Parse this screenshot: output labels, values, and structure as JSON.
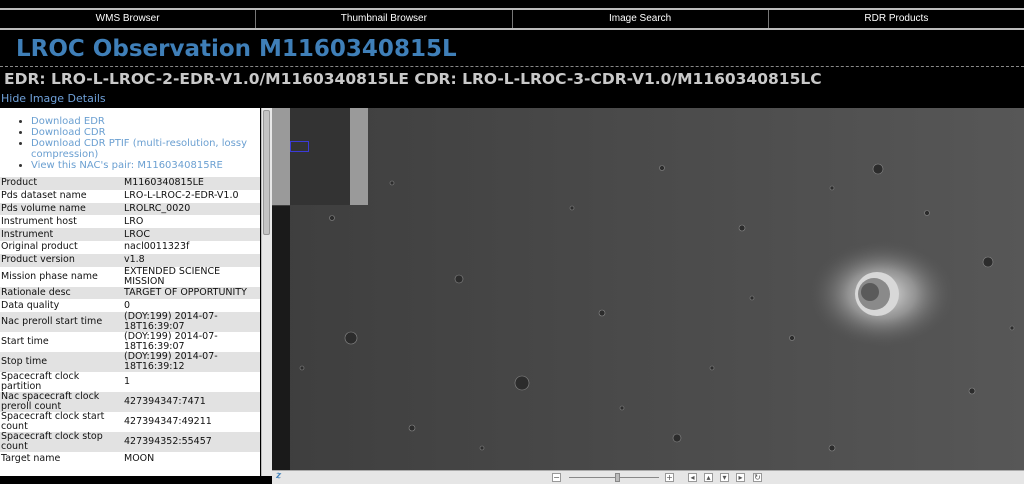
{
  "nav": {
    "items": [
      {
        "label": "WMS Browser"
      },
      {
        "label": "Thumbnail Browser"
      },
      {
        "label": "Image Search"
      },
      {
        "label": "RDR Products"
      }
    ]
  },
  "header": {
    "title": "LROC Observation M1160340815L",
    "subtitle": "EDR: LRO-L-LROC-2-EDR-V1.0/M1160340815LE CDR: LRO-L-LROC-3-CDR-V1.0/M1160340815LC",
    "toggle_label": "Hide Image Details"
  },
  "downloads": [
    {
      "label": "Download EDR"
    },
    {
      "label": "Download CDR"
    },
    {
      "label": "Download CDR PTIF (multi-resolution, lossy compression)"
    },
    {
      "label": "View this NAC's pair: M1160340815RE"
    }
  ],
  "details": [
    {
      "key": "Product",
      "value": "M1160340815LE"
    },
    {
      "key": "Pds dataset name",
      "value": "LRO-L-LROC-2-EDR-V1.0"
    },
    {
      "key": "Pds volume name",
      "value": "LROLRC_0020"
    },
    {
      "key": "Instrument host",
      "value": "LRO"
    },
    {
      "key": "Instrument",
      "value": "LROC"
    },
    {
      "key": "Original product",
      "value": "nacl0011323f"
    },
    {
      "key": "Product version",
      "value": "v1.8"
    },
    {
      "key": "Mission phase name",
      "value": "EXTENDED SCIENCE MISSION"
    },
    {
      "key": "Rationale desc",
      "value": "TARGET OF OPPORTUNITY"
    },
    {
      "key": "Data quality",
      "value": "0"
    },
    {
      "key": "Nac preroll start time",
      "value": "(DOY:199) 2014-07-18T16:39:07"
    },
    {
      "key": "Start time",
      "value": "(DOY:199) 2014-07-18T16:39:07"
    },
    {
      "key": "Stop time",
      "value": "(DOY:199) 2014-07-18T16:39:12"
    },
    {
      "key": "Spacecraft clock partition",
      "value": "1"
    },
    {
      "key": "Nac spacecraft clock preroll count",
      "value": "427394347:7471"
    },
    {
      "key": "Spacecraft clock start count",
      "value": "427394347:49211"
    },
    {
      "key": "Spacecraft clock stop count",
      "value": "427394352:55457"
    },
    {
      "key": "Target name",
      "value": "MOON"
    }
  ],
  "viewer": {
    "zoom_label": "z",
    "controls": {
      "zoom_out": "−",
      "zoom_in": "+",
      "pan_left": "◂",
      "pan_up": "▴",
      "pan_down": "▾",
      "pan_right": "▸",
      "reset": "↻"
    }
  }
}
